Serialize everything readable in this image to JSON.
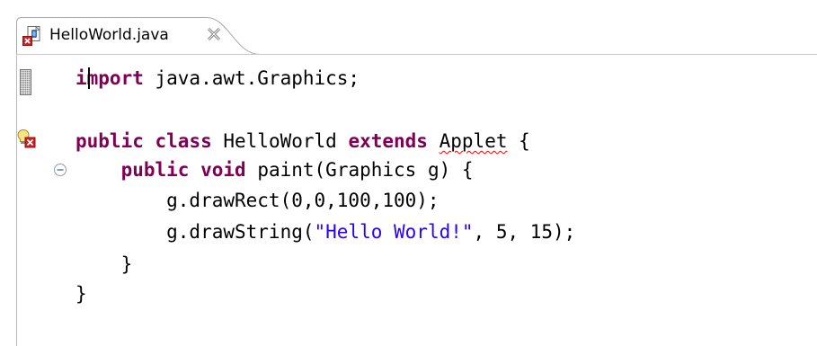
{
  "tab": {
    "filename": "HelloWorld.java",
    "icon": "java-file-error-icon",
    "close_icon": "close-icon"
  },
  "gutter": {
    "overview_marker": "overview-ruler-marker",
    "warning_icon": "warning-quick-fix-icon",
    "fold_icon": "collapse-fold-icon"
  },
  "code": {
    "line1": {
      "kw_import": "import",
      "rest": " java.awt.Graphics;"
    },
    "line2": {
      "kw_public": "public",
      "sp1": " ",
      "kw_class": "class",
      "name": " HelloWorld ",
      "kw_extends": "extends",
      "sp2": " ",
      "super": "Applet",
      "brace": " {"
    },
    "line3": {
      "indent": "    ",
      "kw_public": "public",
      "sp": " ",
      "kw_void": "void",
      "rest": " paint(Graphics g) {"
    },
    "line4": {
      "text": "        g.drawRect(0,0,100,100);"
    },
    "line5": {
      "pre": "        g.drawString(",
      "str": "\"Hello World!\"",
      "post": ", 5, 15);"
    },
    "line6": {
      "text": "    }"
    },
    "line7": {
      "text": "}"
    }
  },
  "colors": {
    "keyword": "#7f0055",
    "string": "#2a00ff",
    "error_underline": "#ff0000"
  }
}
